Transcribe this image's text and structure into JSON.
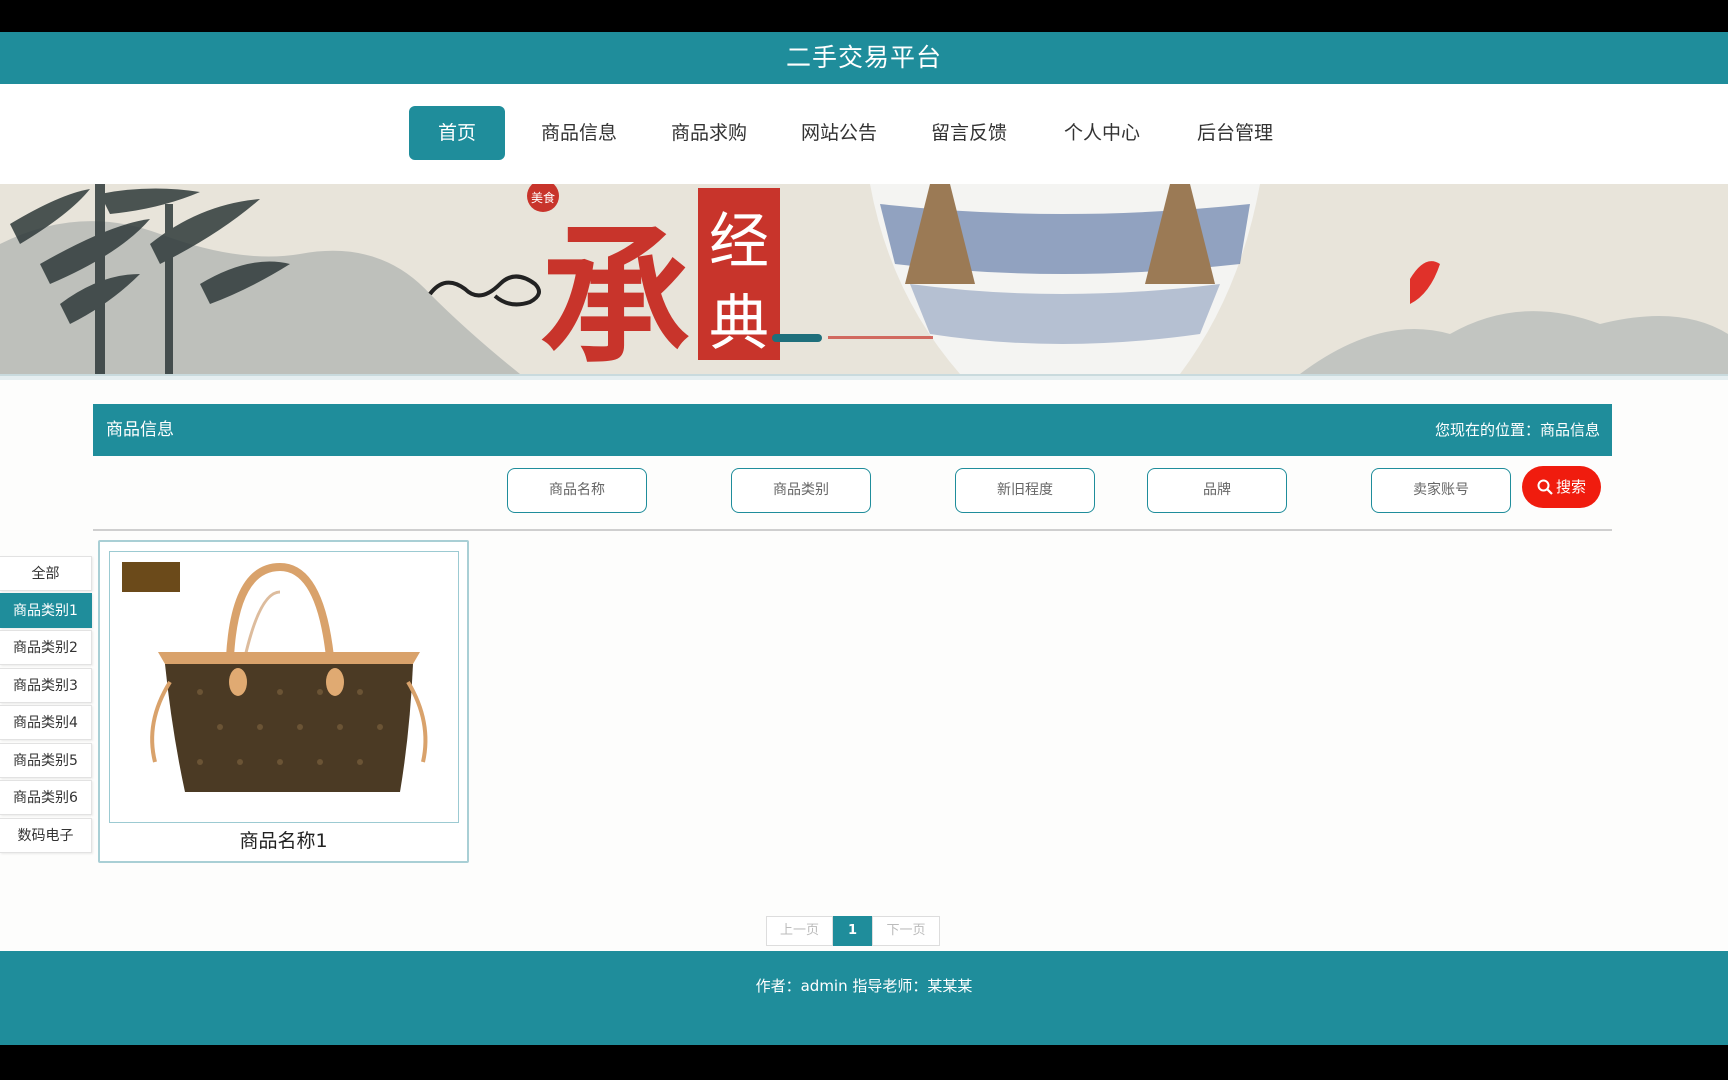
{
  "site": {
    "title": "二手交易平台"
  },
  "nav": {
    "items": [
      {
        "label": "首页",
        "active": true
      },
      {
        "label": "商品信息",
        "active": false
      },
      {
        "label": "商品求购",
        "active": false
      },
      {
        "label": "网站公告",
        "active": false
      },
      {
        "label": "留言反馈",
        "active": false
      },
      {
        "label": "个人中心",
        "active": false
      },
      {
        "label": "后台管理",
        "active": false
      }
    ]
  },
  "banner": {
    "seal_small": "美食",
    "big_char": "承",
    "seal_chars": [
      "经",
      "典"
    ]
  },
  "section": {
    "title": "商品信息",
    "breadcrumb": "您现在的位置：商品信息"
  },
  "filters": {
    "name_placeholder": "商品名称",
    "category_placeholder": "商品类别",
    "condition_placeholder": "新旧程度",
    "brand_placeholder": "品牌",
    "seller_placeholder": "卖家账号",
    "search_label": "搜索"
  },
  "categories": [
    {
      "label": "全部",
      "active": false
    },
    {
      "label": "商品类别1",
      "active": true
    },
    {
      "label": "商品类别2",
      "active": false
    },
    {
      "label": "商品类别3",
      "active": false
    },
    {
      "label": "商品类别4",
      "active": false
    },
    {
      "label": "商品类别5",
      "active": false
    },
    {
      "label": "商品类别6",
      "active": false
    },
    {
      "label": "数码电子",
      "active": false
    }
  ],
  "products": [
    {
      "name": "商品名称1"
    }
  ],
  "pagination": {
    "prev_label": "上一页",
    "current": "1",
    "next_label": "下一页"
  },
  "footer": {
    "text": "作者：admin 指导老师：某某某"
  },
  "colors": {
    "primary": "#1f8d9b",
    "search": "#f01c0e"
  }
}
